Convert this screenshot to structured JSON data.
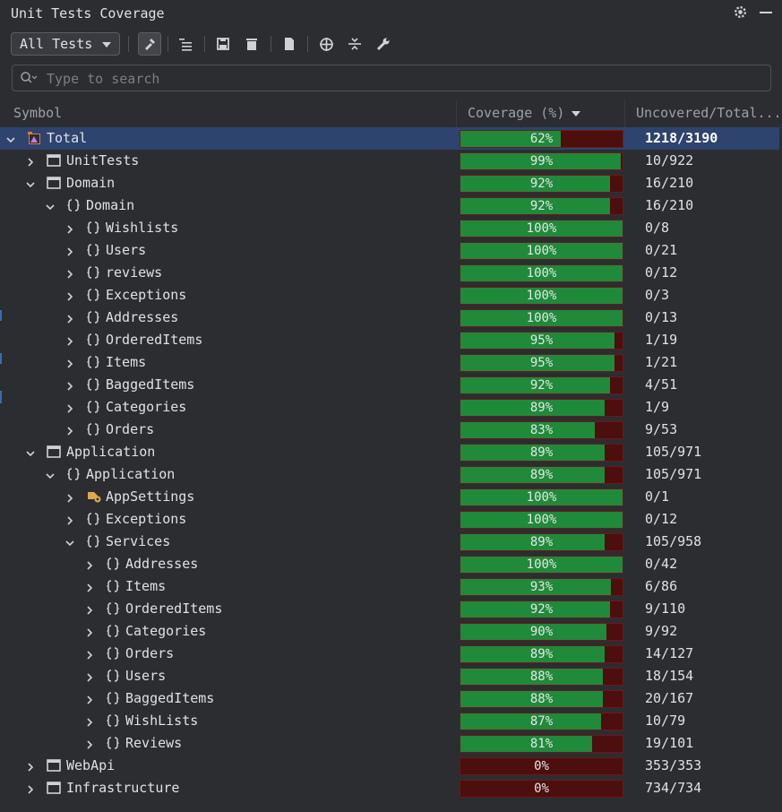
{
  "panel": {
    "title": "Unit Tests Coverage"
  },
  "toolbar": {
    "filter_value": "All Tests"
  },
  "search": {
    "placeholder": "Type to search"
  },
  "columns": {
    "symbol": "Symbol",
    "coverage": "Coverage (%)",
    "uncovered": "Uncovered/Total..."
  },
  "colors": {
    "covered": "#1f8a3a",
    "uncovered": "#4d0e0e",
    "selection": "#2e436e"
  },
  "rows": [
    {
      "label": "Total",
      "level": 0,
      "expanded": true,
      "icon": "coverage-root-icon",
      "coverage": 62,
      "percent_text": "62%",
      "uncovered_total": "1218/3190",
      "selected": true
    },
    {
      "label": "UnitTests",
      "level": 1,
      "expanded": false,
      "icon": "module-icon",
      "coverage": 99,
      "percent_text": "99%",
      "uncovered_total": "10/922"
    },
    {
      "label": "Domain",
      "level": 1,
      "expanded": true,
      "icon": "module-icon",
      "coverage": 92,
      "percent_text": "92%",
      "uncovered_total": "16/210"
    },
    {
      "label": "Domain",
      "level": 2,
      "expanded": true,
      "icon": "namespace-icon",
      "coverage": 92,
      "percent_text": "92%",
      "uncovered_total": "16/210"
    },
    {
      "label": "Wishlists",
      "level": 3,
      "expanded": false,
      "icon": "namespace-icon",
      "coverage": 100,
      "percent_text": "100%",
      "uncovered_total": "0/8"
    },
    {
      "label": "Users",
      "level": 3,
      "expanded": false,
      "icon": "namespace-icon",
      "coverage": 100,
      "percent_text": "100%",
      "uncovered_total": "0/21"
    },
    {
      "label": "reviews",
      "level": 3,
      "expanded": false,
      "icon": "namespace-icon",
      "coverage": 100,
      "percent_text": "100%",
      "uncovered_total": "0/12"
    },
    {
      "label": "Exceptions",
      "level": 3,
      "expanded": false,
      "icon": "namespace-icon",
      "coverage": 100,
      "percent_text": "100%",
      "uncovered_total": "0/3"
    },
    {
      "label": "Addresses",
      "level": 3,
      "expanded": false,
      "icon": "namespace-icon",
      "coverage": 100,
      "percent_text": "100%",
      "uncovered_total": "0/13"
    },
    {
      "label": "OrderedItems",
      "level": 3,
      "expanded": false,
      "icon": "namespace-icon",
      "coverage": 95,
      "percent_text": "95%",
      "uncovered_total": "1/19"
    },
    {
      "label": "Items",
      "level": 3,
      "expanded": false,
      "icon": "namespace-icon",
      "coverage": 95,
      "percent_text": "95%",
      "uncovered_total": "1/21"
    },
    {
      "label": "BaggedItems",
      "level": 3,
      "expanded": false,
      "icon": "namespace-icon",
      "coverage": 92,
      "percent_text": "92%",
      "uncovered_total": "4/51"
    },
    {
      "label": "Categories",
      "level": 3,
      "expanded": false,
      "icon": "namespace-icon",
      "coverage": 89,
      "percent_text": "89%",
      "uncovered_total": "1/9"
    },
    {
      "label": "Orders",
      "level": 3,
      "expanded": false,
      "icon": "namespace-icon",
      "coverage": 83,
      "percent_text": "83%",
      "uncovered_total": "9/53"
    },
    {
      "label": "Application",
      "level": 1,
      "expanded": true,
      "icon": "module-icon",
      "coverage": 89,
      "percent_text": "89%",
      "uncovered_total": "105/971"
    },
    {
      "label": "Application",
      "level": 2,
      "expanded": true,
      "icon": "namespace-icon",
      "coverage": 89,
      "percent_text": "89%",
      "uncovered_total": "105/971"
    },
    {
      "label": "AppSettings",
      "level": 3,
      "expanded": false,
      "icon": "settings-class-icon",
      "coverage": 100,
      "percent_text": "100%",
      "uncovered_total": "0/1"
    },
    {
      "label": "Exceptions",
      "level": 3,
      "expanded": false,
      "icon": "namespace-icon",
      "coverage": 100,
      "percent_text": "100%",
      "uncovered_total": "0/12"
    },
    {
      "label": "Services",
      "level": 3,
      "expanded": true,
      "icon": "namespace-icon",
      "coverage": 89,
      "percent_text": "89%",
      "uncovered_total": "105/958"
    },
    {
      "label": "Addresses",
      "level": 4,
      "expanded": false,
      "icon": "namespace-icon",
      "coverage": 100,
      "percent_text": "100%",
      "uncovered_total": "0/42"
    },
    {
      "label": "Items",
      "level": 4,
      "expanded": false,
      "icon": "namespace-icon",
      "coverage": 93,
      "percent_text": "93%",
      "uncovered_total": "6/86"
    },
    {
      "label": "OrderedItems",
      "level": 4,
      "expanded": false,
      "icon": "namespace-icon",
      "coverage": 92,
      "percent_text": "92%",
      "uncovered_total": "9/110"
    },
    {
      "label": "Categories",
      "level": 4,
      "expanded": false,
      "icon": "namespace-icon",
      "coverage": 90,
      "percent_text": "90%",
      "uncovered_total": "9/92"
    },
    {
      "label": "Orders",
      "level": 4,
      "expanded": false,
      "icon": "namespace-icon",
      "coverage": 89,
      "percent_text": "89%",
      "uncovered_total": "14/127"
    },
    {
      "label": "Users",
      "level": 4,
      "expanded": false,
      "icon": "namespace-icon",
      "coverage": 88,
      "percent_text": "88%",
      "uncovered_total": "18/154"
    },
    {
      "label": "BaggedItems",
      "level": 4,
      "expanded": false,
      "icon": "namespace-icon",
      "coverage": 88,
      "percent_text": "88%",
      "uncovered_total": "20/167"
    },
    {
      "label": "WishLists",
      "level": 4,
      "expanded": false,
      "icon": "namespace-icon",
      "coverage": 87,
      "percent_text": "87%",
      "uncovered_total": "10/79"
    },
    {
      "label": "Reviews",
      "level": 4,
      "expanded": false,
      "icon": "namespace-icon",
      "coverage": 81,
      "percent_text": "81%",
      "uncovered_total": "19/101"
    },
    {
      "label": "WebApi",
      "level": 1,
      "expanded": false,
      "icon": "module-icon",
      "coverage": 0,
      "percent_text": "0%",
      "uncovered_total": "353/353"
    },
    {
      "label": "Infrastructure",
      "level": 1,
      "expanded": false,
      "icon": "module-icon",
      "coverage": 0,
      "percent_text": "0%",
      "uncovered_total": "734/734"
    }
  ]
}
